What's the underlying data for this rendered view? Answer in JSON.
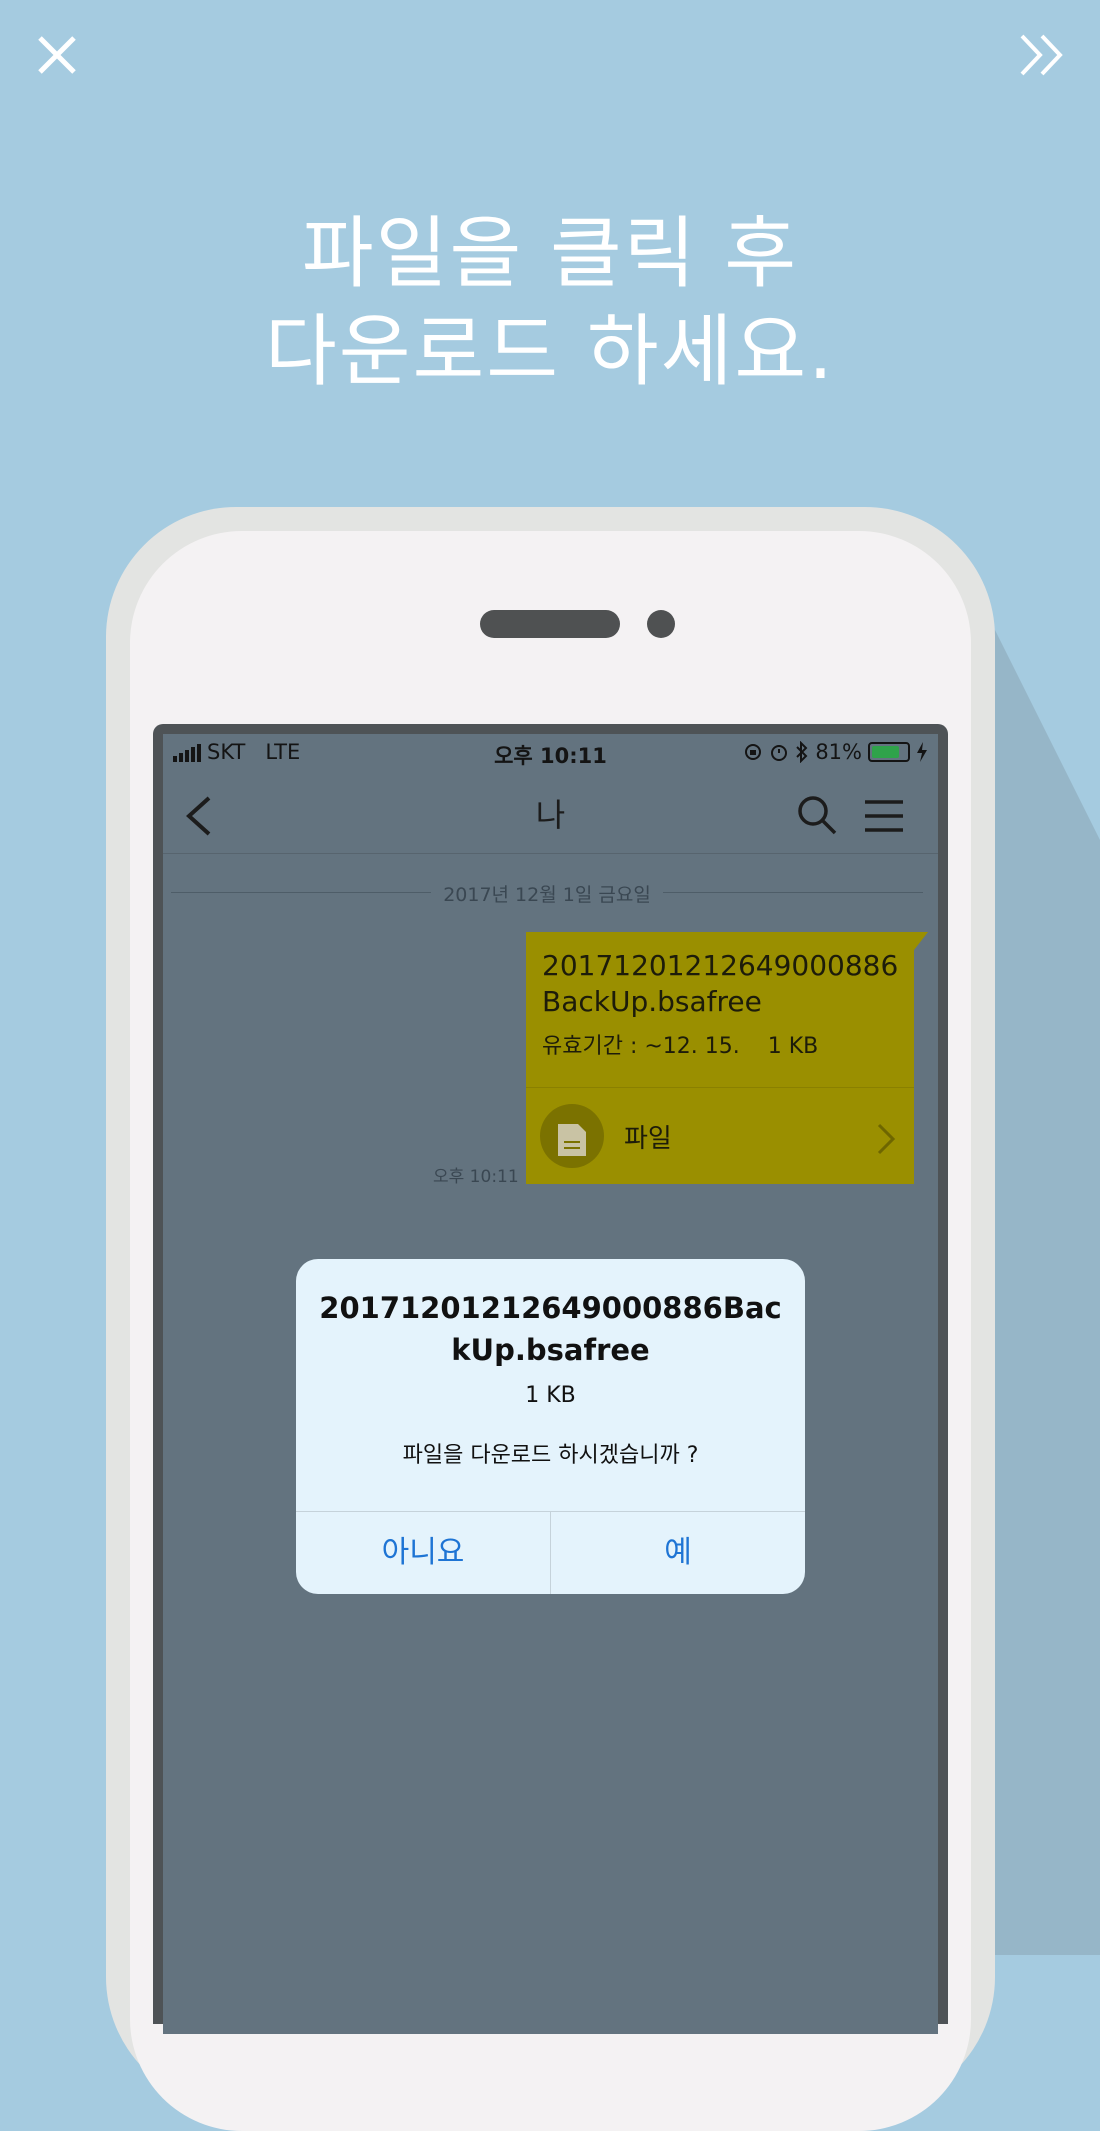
{
  "nav": {
    "close_glyph": "X"
  },
  "headline": {
    "line1": "파일을 클릭 후",
    "line2": "다운로드 하세요."
  },
  "status_bar": {
    "carrier": "SKT   LTE",
    "time": "오후 10:11",
    "battery": "81%",
    "battery_level": 0.81
  },
  "chat": {
    "title": "나",
    "date_divider": "2017년 12월 1일 금요일",
    "message": {
      "filename": "20171201212649000886BackUp.bsafree",
      "filename_line1": "20171201212649000886",
      "filename_line2": "BackUp.bsafree",
      "meta": "유효기간 : ~12. 15.    1 KB",
      "file_label": "파일",
      "time": "오후 10:11"
    }
  },
  "dialog": {
    "title_line1": "20171201212649000886Bac",
    "title_line2": "kUp.bsafree",
    "size": "1 KB",
    "message": "파일을 다운로드 하시겠습니까 ?",
    "no_label": "아니요",
    "yes_label": "예"
  },
  "colors": {
    "background": "#a5cbe0",
    "bubble": "#9a8f00",
    "dialog_bg": "#e4f3fc",
    "dialog_button": "#1e74d4",
    "battery": "#2fa34a"
  }
}
